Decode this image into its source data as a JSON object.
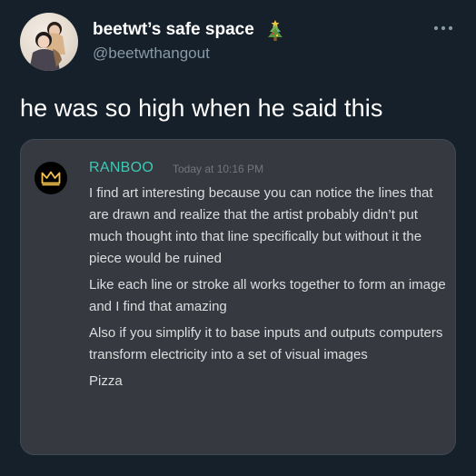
{
  "tweet": {
    "display_name": "beetwt’s safe space",
    "display_name_emoji": "christmas-tree-icon",
    "handle": "@beetwthangout",
    "text": "he was so high when he said this",
    "more_icon": "more-horizontal-icon"
  },
  "discord": {
    "username": "RANBOO",
    "username_color": "#3fc9b6",
    "timestamp": "Today at 10:16 PM",
    "avatar_icon": "crown-icon",
    "messages": [
      "I find art interesting because you can notice the lines that are drawn and realize that the artist probably didn’t put much thought into that line specifically but without it the piece would be ruined",
      "Like each line or stroke all works together to form an image and I find that amazing",
      "Also if you simplify it to base inputs and outputs computers transform electricity into a set of visual images",
      "Pizza"
    ]
  },
  "colors": {
    "background": "#15202b",
    "card_background": "#36393f",
    "handle_text": "#8899a6",
    "message_text": "#dcddde"
  }
}
